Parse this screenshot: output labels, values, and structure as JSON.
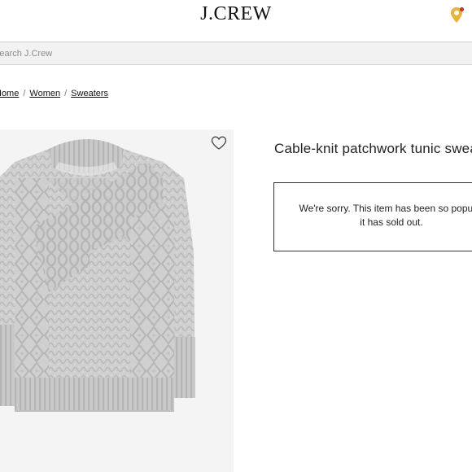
{
  "header": {
    "logo_text": "J.CREW",
    "location_pin_icon": "location-pin-icon",
    "pin_color": "#e8b33a",
    "notification_dot_color": "#c0392b"
  },
  "search": {
    "placeholder": "Search J.Crew"
  },
  "breadcrumb": {
    "items": [
      "Home",
      "Women",
      "Sweaters"
    ],
    "separator": "/"
  },
  "product": {
    "title": "Cable-knit patchwork tunic sweater",
    "favorite_icon": "heart-outline-icon",
    "image_alt": "Gray cable-knit patchwork tunic sweater"
  },
  "notice": {
    "line1": "We're sorry. This item has been so popular",
    "line2": "it has sold out."
  }
}
